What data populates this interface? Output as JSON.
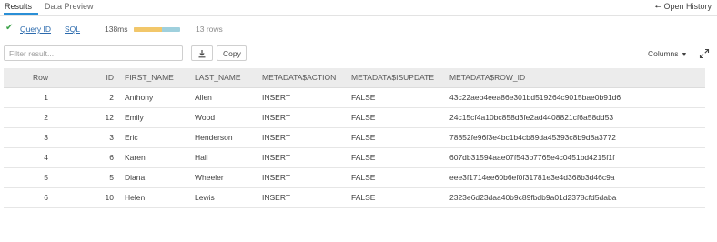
{
  "tabs": {
    "results_label": "Results",
    "preview_label": "Data Preview",
    "open_history_label": "Open History"
  },
  "query": {
    "query_id_label": "Query ID",
    "sql_label": "SQL",
    "duration": "138ms",
    "progress_fraction": 0.6,
    "row_count": "13 rows"
  },
  "toolbar": {
    "filter_placeholder": "Filter result...",
    "copy_label": "Copy",
    "columns_label": "Columns"
  },
  "table": {
    "headers": [
      "Row",
      "ID",
      "FIRST_NAME",
      "LAST_NAME",
      "METADATA$ACTION",
      "METADATA$ISUPDATE",
      "METADATA$ROW_ID"
    ],
    "rows": [
      [
        "1",
        "2",
        "Anthony",
        "Allen",
        "INSERT",
        "FALSE",
        "43c22aeb4eea86e301bd519264c9015bae0b91d6"
      ],
      [
        "2",
        "12",
        "Emily",
        "Wood",
        "INSERT",
        "FALSE",
        "24c15cf4a10bc858d3fe2ad4408821cf6a58dd53"
      ],
      [
        "3",
        "3",
        "Eric",
        "Henderson",
        "INSERT",
        "FALSE",
        "78852fe96f3e4bc1b4cb89da45393c8b9d8a3772"
      ],
      [
        "4",
        "6",
        "Karen",
        "Hall",
        "INSERT",
        "FALSE",
        "607db31594aae07f543b7765e4c0451bd4215f1f"
      ],
      [
        "5",
        "5",
        "Diana",
        "Wheeler",
        "INSERT",
        "FALSE",
        "eee3f1714ee60b6ef0f31781e3e4d368b3d46c9a"
      ],
      [
        "6",
        "10",
        "Helen",
        "Lewis",
        "INSERT",
        "FALSE",
        "2323e6d23daa40b9c89fbdb9a01d2378cfd5daba"
      ]
    ]
  }
}
